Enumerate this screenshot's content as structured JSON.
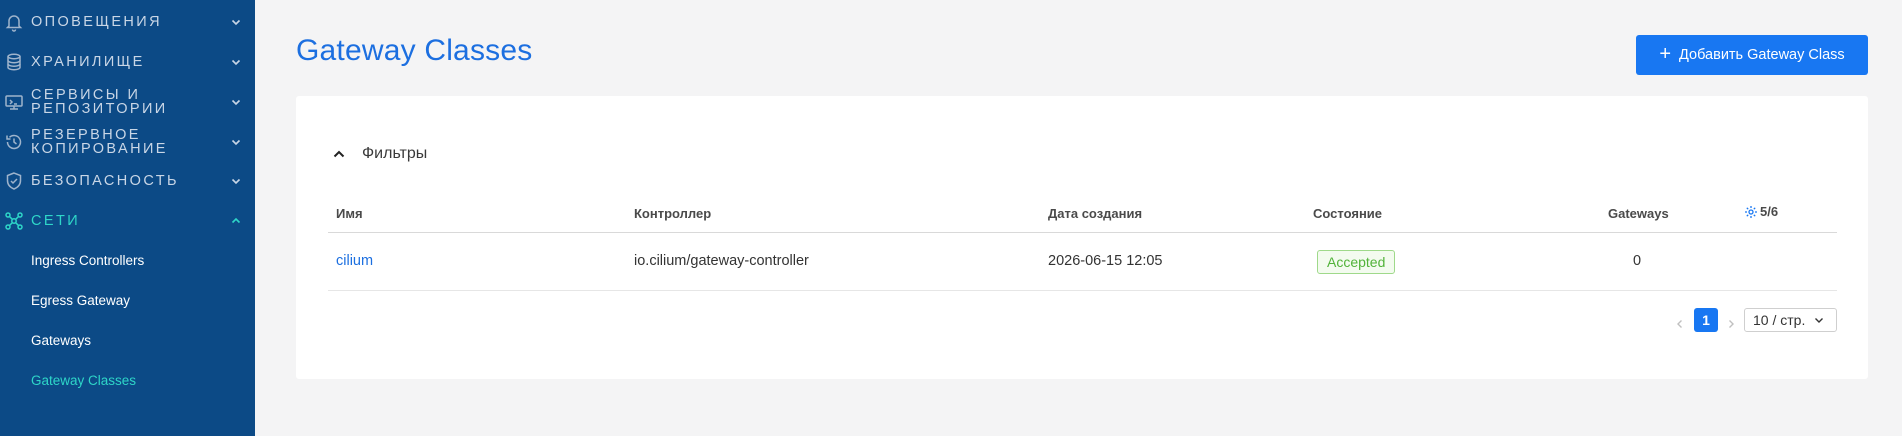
{
  "sidebar": {
    "groups": [
      {
        "label": "Оповещения",
        "icon": "bell-icon",
        "expanded": false
      },
      {
        "label": "Хранилище",
        "icon": "database-icon",
        "expanded": false
      },
      {
        "label": "Сервисы и\nрепозитории",
        "icon": "services-icon",
        "expanded": false
      },
      {
        "label": "Резервное\nкопирование",
        "icon": "backup-icon",
        "expanded": false
      },
      {
        "label": "Безопасность",
        "icon": "shield-icon",
        "expanded": false
      },
      {
        "label": "Сети",
        "icon": "network-icon",
        "expanded": true
      }
    ],
    "sub_items": [
      {
        "label": "Ingress Controllers",
        "active": false
      },
      {
        "label": "Egress Gateway",
        "active": false
      },
      {
        "label": "Gateways",
        "active": false
      },
      {
        "label": "Gateway Classes",
        "active": true
      }
    ]
  },
  "page": {
    "title": "Gateway Classes",
    "add_button": "Добавить Gateway Class"
  },
  "filters": {
    "label": "Фильтры",
    "expanded": true
  },
  "table": {
    "headers": [
      "Имя",
      "Контроллер",
      "Дата создания",
      "Состояние",
      "Gateways"
    ],
    "columns_visible": "5/6",
    "rows": [
      {
        "name": "cilium",
        "controller": "io.cilium/gateway-controller",
        "created": "2026-06-15 12:05",
        "status": "Accepted",
        "gateways": "0"
      }
    ]
  },
  "pagination": {
    "current_page": "1",
    "page_size": "10 / стр."
  },
  "colors": {
    "sidebar_bg": "#0c4a86",
    "accent": "#1877f2",
    "active_nav": "#2ed6c8",
    "status_ok": "#52b33a"
  }
}
